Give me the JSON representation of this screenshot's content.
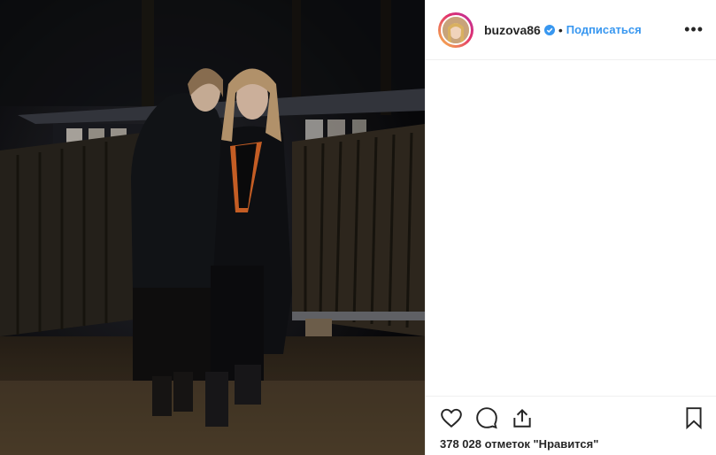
{
  "post": {
    "username": "buzova86",
    "verified": true,
    "follow_label": "Подписаться",
    "separator": "•",
    "more_label": "•••",
    "likes_text": "378 028 отметок \"Нравится\""
  },
  "icons": {
    "like": "heart-icon",
    "comment": "comment-icon",
    "share": "share-icon",
    "save": "bookmark-icon",
    "verified": "verified-badge-icon",
    "more": "more-options-icon"
  },
  "colors": {
    "accent": "#3897f0",
    "text": "#262626",
    "border": "#efefef"
  }
}
